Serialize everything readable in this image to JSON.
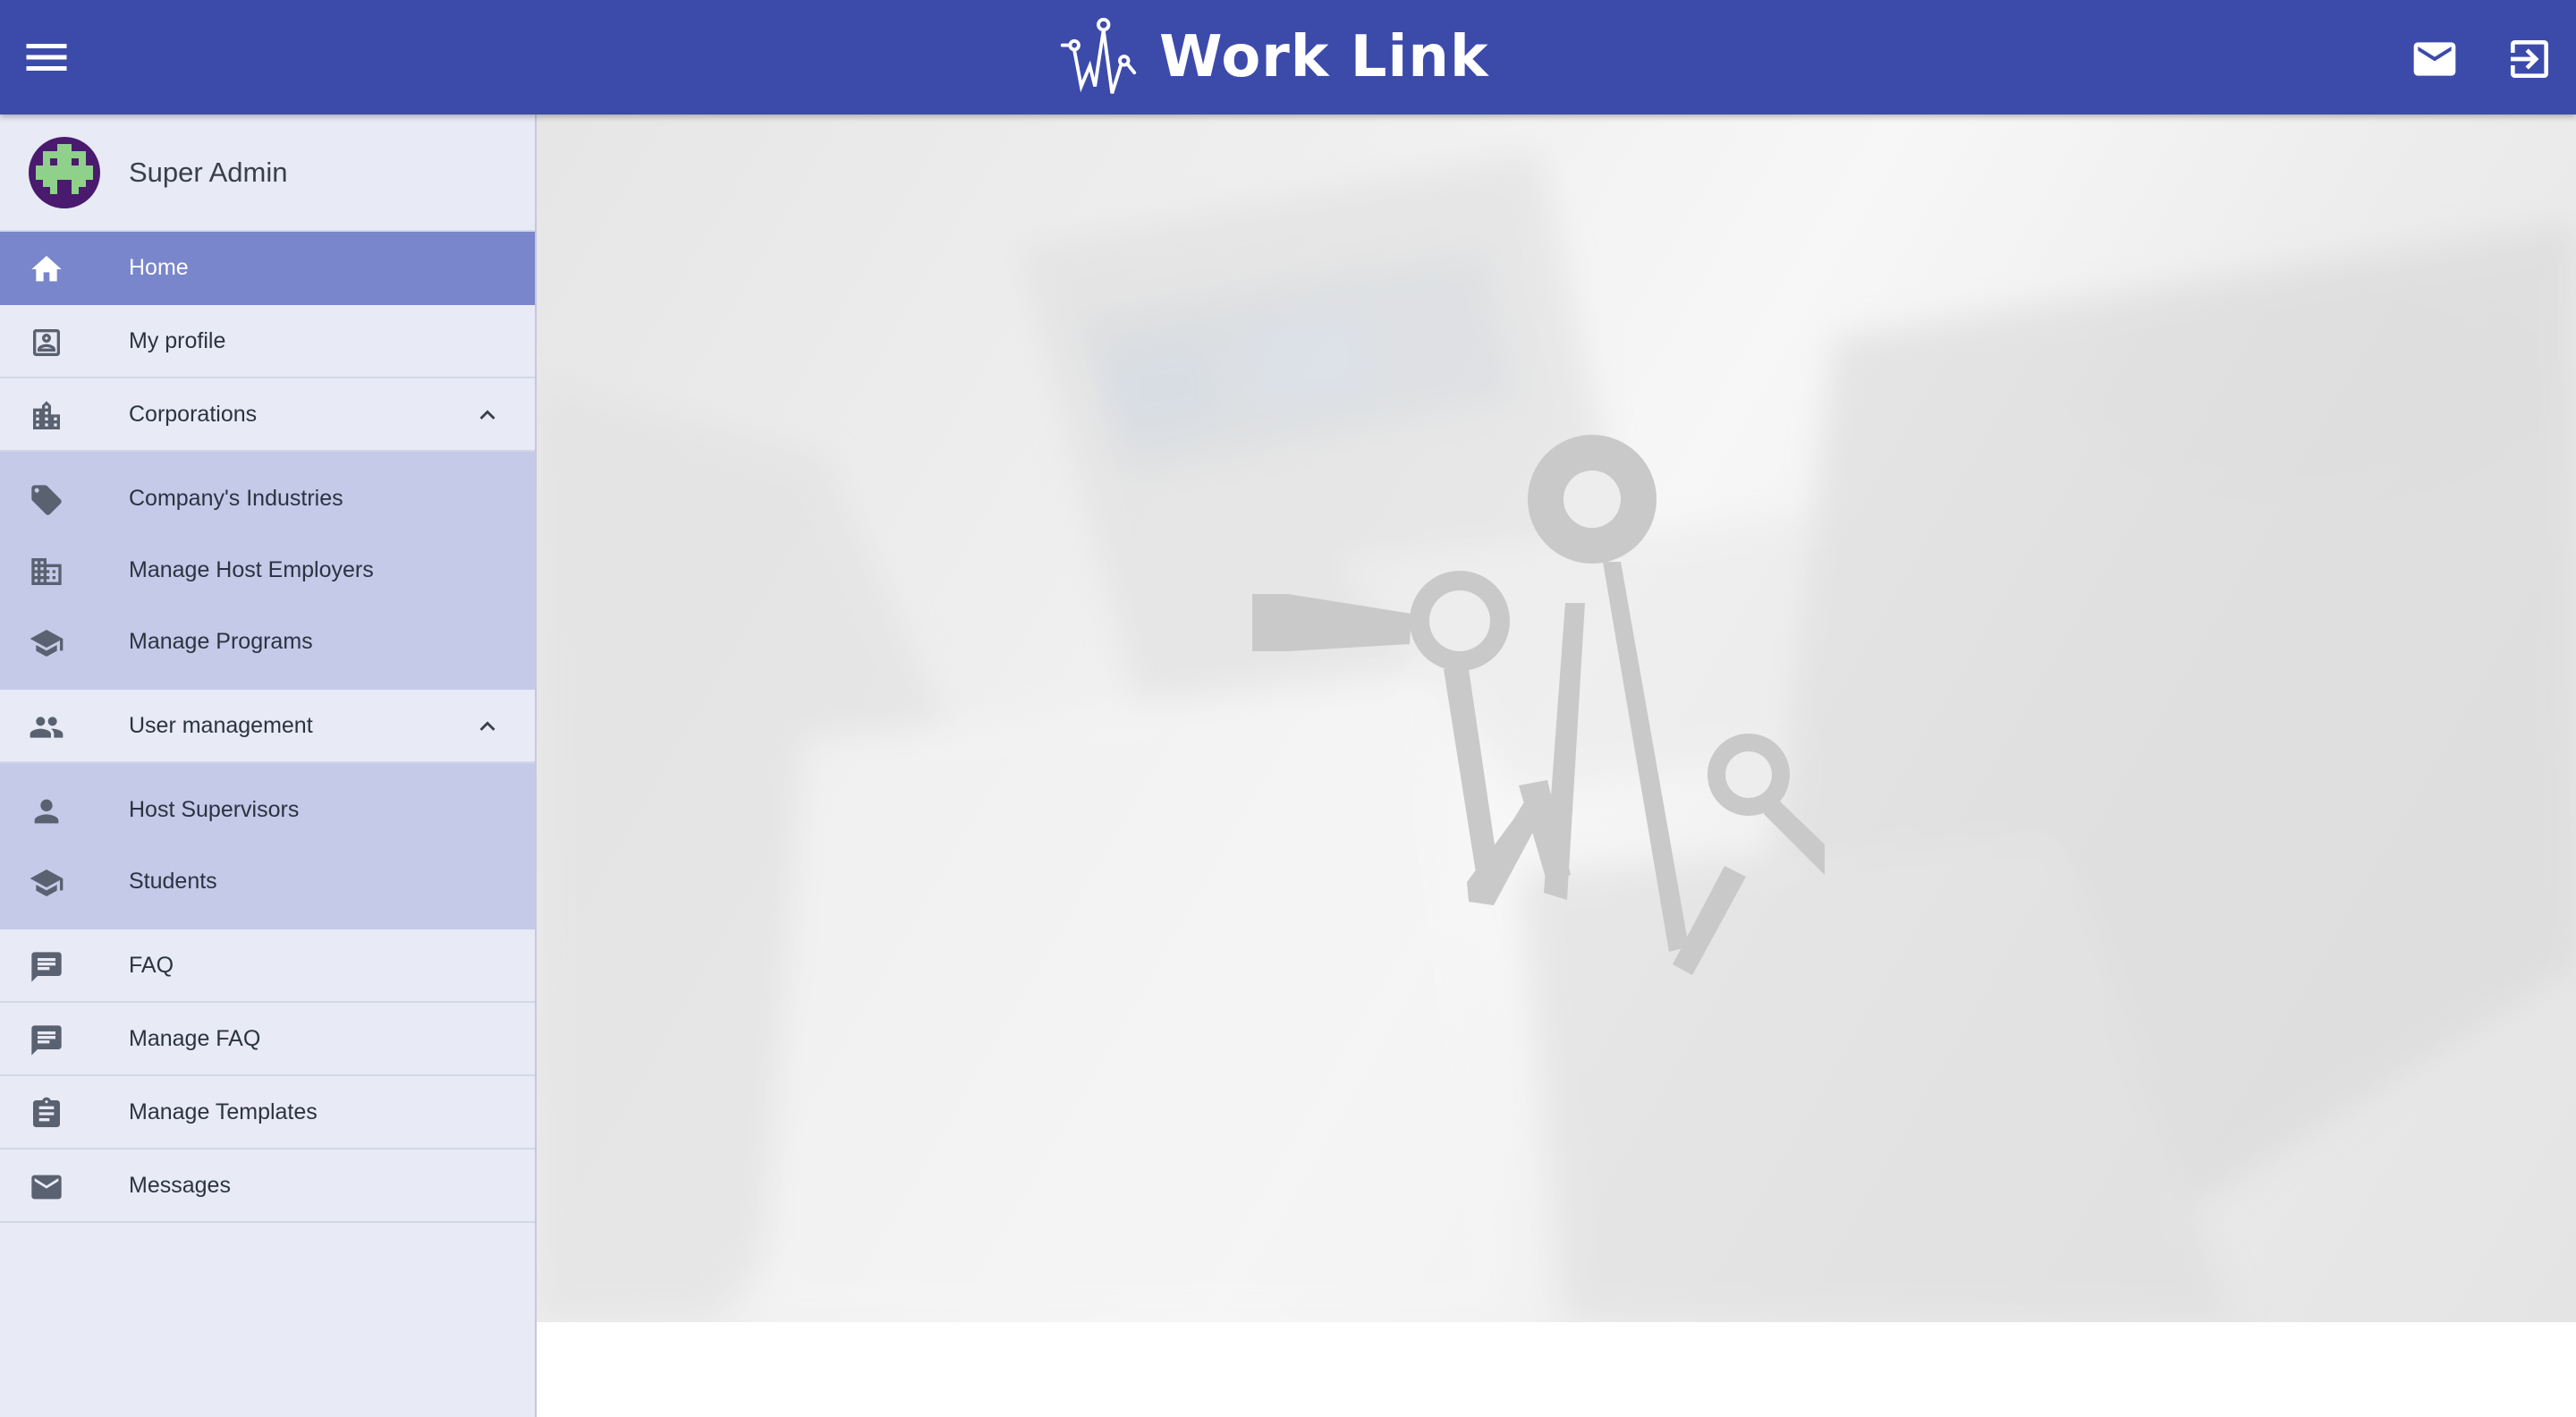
{
  "header": {
    "app_title": "Work Link",
    "icons": {
      "menu": "menu-icon",
      "mail": "mail-icon",
      "logout": "logout-icon",
      "logo": "worklink-logo"
    },
    "colors": {
      "bar": "#3c4baa",
      "text": "#ffffff"
    }
  },
  "sidebar": {
    "user": {
      "name": "Super Admin",
      "avatar": "pixel-invader-avatar"
    },
    "items": [
      {
        "label": "Home",
        "icon": "home-icon",
        "active": true
      },
      {
        "label": "My profile",
        "icon": "profile-card-icon"
      },
      {
        "label": "Corporations",
        "icon": "city-icon",
        "expanded": true,
        "children": [
          {
            "label": "Company's Industries",
            "icon": "tag-icon"
          },
          {
            "label": "Manage Host Employers",
            "icon": "building-icon"
          },
          {
            "label": "Manage Programs",
            "icon": "school-icon"
          }
        ]
      },
      {
        "label": "User management",
        "icon": "people-icon",
        "expanded": true,
        "children": [
          {
            "label": "Host Supervisors",
            "icon": "person-icon"
          },
          {
            "label": "Students",
            "icon": "school-icon"
          }
        ]
      },
      {
        "label": "FAQ",
        "icon": "chat-icon"
      },
      {
        "label": "Manage FAQ",
        "icon": "chat-icon"
      },
      {
        "label": "Manage Templates",
        "icon": "clipboard-icon"
      },
      {
        "label": "Messages",
        "icon": "mail-icon"
      }
    ],
    "colors": {
      "background": "#e8eaf6",
      "active": "#7986cb",
      "subgroup": "#c5cae9"
    }
  }
}
